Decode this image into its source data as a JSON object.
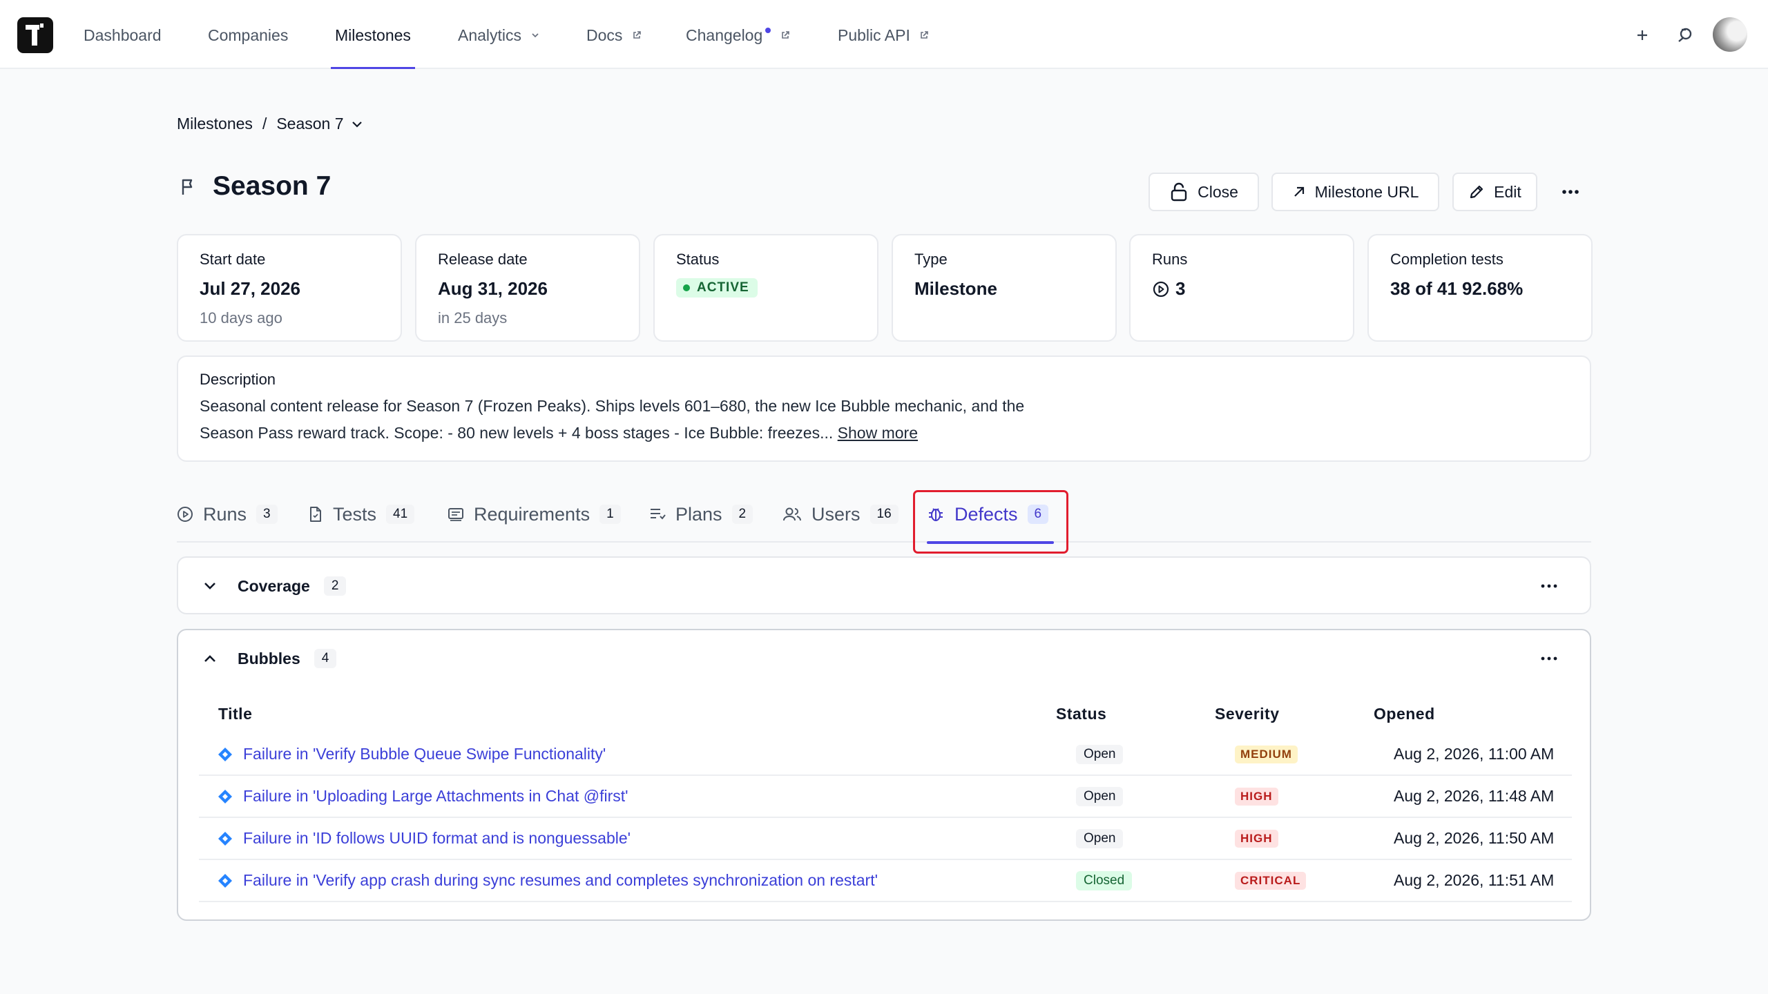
{
  "nav": {
    "items": [
      {
        "label": "Dashboard"
      },
      {
        "label": "Companies"
      },
      {
        "label": "Milestones"
      },
      {
        "label": "Analytics"
      },
      {
        "label": "Docs"
      },
      {
        "label": "Changelog"
      },
      {
        "label": "Public API"
      }
    ],
    "active": "Milestones",
    "icons": [
      "plus-icon",
      "user-switch-icon"
    ]
  },
  "breadcrumb": {
    "parent": "Milestones",
    "separator": "/",
    "current": "Season 7"
  },
  "header": {
    "title": "Season 7",
    "buttons": {
      "close": "Close",
      "milestone_url": "Milestone URL",
      "edit": "Edit"
    }
  },
  "stats": {
    "start": {
      "label": "Start date",
      "value": "Jul 27, 2026",
      "sub": "10 days ago"
    },
    "release": {
      "label": "Release date",
      "value": "Aug 31, 2026",
      "sub": "in 25 days"
    },
    "status": {
      "label": "Status",
      "value": "ACTIVE"
    },
    "type": {
      "label": "Type",
      "value": "Milestone"
    },
    "runs": {
      "label": "Runs",
      "value": "3"
    },
    "completion": {
      "label": "Completion tests",
      "value": "38 of 41 92.68%"
    }
  },
  "description": {
    "label": "Description",
    "text": "Seasonal content release for Season 7 (Frozen Peaks). Ships levels 601–680, the new Ice Bubble mechanic, and the Season Pass reward track. Scope: - 80 new levels + 4 boss stages - Ice Bubble: freezes...",
    "show_more": "Show more"
  },
  "tabs": [
    {
      "label": "Runs",
      "count": "3"
    },
    {
      "label": "Tests",
      "count": "41"
    },
    {
      "label": "Requirements",
      "count": "1"
    },
    {
      "label": "Plans",
      "count": "2"
    },
    {
      "label": "Users",
      "count": "16"
    },
    {
      "label": "Defects",
      "count": "6"
    }
  ],
  "active_tab": "Defects",
  "groups": {
    "coverage": {
      "title": "Coverage",
      "count": "2",
      "expanded": false
    },
    "bubbles": {
      "title": "Bubbles",
      "count": "4",
      "expanded": true,
      "columns": {
        "title": "Title",
        "status": "Status",
        "severity": "Severity",
        "opened": "Opened"
      },
      "rows": [
        {
          "title": "Failure in 'Verify Bubble Queue Swipe Functionality'",
          "status": "Open",
          "severity": "MEDIUM",
          "opened": "Aug 2, 2026, 11:00 AM"
        },
        {
          "title": "Failure in 'Uploading Large Attachments in Chat @first'",
          "status": "Open",
          "severity": "HIGH",
          "opened": "Aug 2, 2026, 11:48 AM"
        },
        {
          "title": "Failure in 'ID follows UUID format and is nonguessable'",
          "status": "Open",
          "severity": "HIGH",
          "opened": "Aug 2, 2026, 11:50 AM"
        },
        {
          "title": "Failure in 'Verify app crash during sync resumes and completes synchronization on restart'",
          "status": "Closed",
          "severity": "CRITICAL",
          "opened": "Aug 2, 2026, 11:51 AM"
        }
      ]
    }
  },
  "colors": {
    "accent": "#4f46e5",
    "highlight": "#e11d2e",
    "link": "#3b3fd8"
  }
}
